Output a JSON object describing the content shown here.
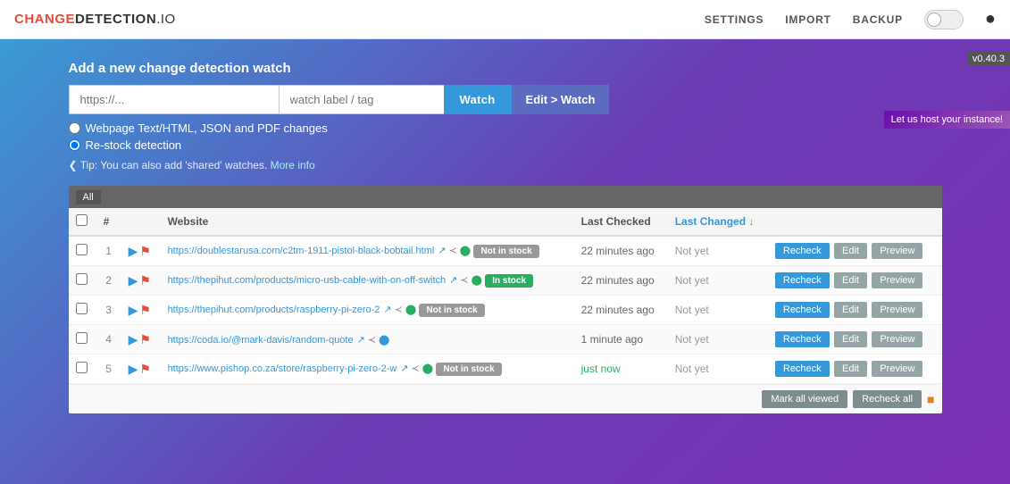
{
  "header": {
    "logo_change": "CHANGE",
    "logo_detection": "DETECTION",
    "logo_io": ".IO",
    "nav": {
      "settings": "SETTINGS",
      "import": "IMPORT",
      "backup": "BACKUP"
    }
  },
  "version": "v0.40.3",
  "host_banner": "Let us host your instance!",
  "form": {
    "title": "Add a new change detection watch",
    "url_placeholder": "https://...",
    "label_placeholder": "watch label / tag",
    "watch_btn": "Watch",
    "edit_watch_btn": "Edit > Watch",
    "radio1": "Webpage Text/HTML, JSON and PDF changes",
    "radio2": "Re-stock detection",
    "tip": "Tip: You can also add 'shared' watches.",
    "tip_link": "More info"
  },
  "table": {
    "all_badge": "All",
    "columns": {
      "checkbox": "",
      "num": "#",
      "icons": "",
      "website": "Website",
      "last_checked": "Last Checked",
      "last_changed": "Last Changed"
    },
    "sort_arrow": "↓",
    "rows": [
      {
        "num": "1",
        "url": "https://doublestarusa.com/c2tm-1911-pistol-black-bobtail.html",
        "url_short": "https://doublestarusa.com/c2tm-1911-pistol-black-bobtail.html",
        "status": "Not in stock",
        "status_class": "status-not-in-stock",
        "last_checked": "22 minutes ago",
        "last_changed": "Not yet",
        "last_changed_class": "not-yet"
      },
      {
        "num": "2",
        "url": "https://thepihut.com/products/micro-usb-cable-with-on-off-switch",
        "url_short": "https://thepihut.com/products/micro-usb-cable-with-on-off-switch",
        "status": "In stock",
        "status_class": "status-in-stock",
        "last_checked": "22 minutes ago",
        "last_changed": "Not yet",
        "last_changed_class": "not-yet"
      },
      {
        "num": "3",
        "url": "https://thepihut.com/products/raspberry-pi-zero-2",
        "url_short": "https://thepihut.com/products/raspberry-pi-zero-2",
        "status": "Not in stock",
        "status_class": "status-not-in-stock",
        "last_checked": "22 minutes ago",
        "last_changed": "Not yet",
        "last_changed_class": "not-yet"
      },
      {
        "num": "4",
        "url": "https://coda.io/@mark-davis/random-quote",
        "url_short": "https://coda.io/@mark-davis/random-quote",
        "status": "",
        "status_class": "",
        "last_checked": "1 minute ago",
        "last_changed": "Not yet",
        "last_changed_class": "not-yet"
      },
      {
        "num": "5",
        "url": "https://www.pishop.co.za/store/raspberry-pi-zero-2-w",
        "url_short": "https://www.pishop.co.za/store/raspberry-pi-zero-2-w",
        "status": "Not in stock",
        "status_class": "status-not-in-stock",
        "last_checked": "just now",
        "last_checked_class": "just-now",
        "last_changed": "Not yet",
        "last_changed_class": "not-yet"
      }
    ],
    "footer": {
      "mark_all": "Mark all viewed",
      "recheck_all": "Recheck all"
    }
  }
}
